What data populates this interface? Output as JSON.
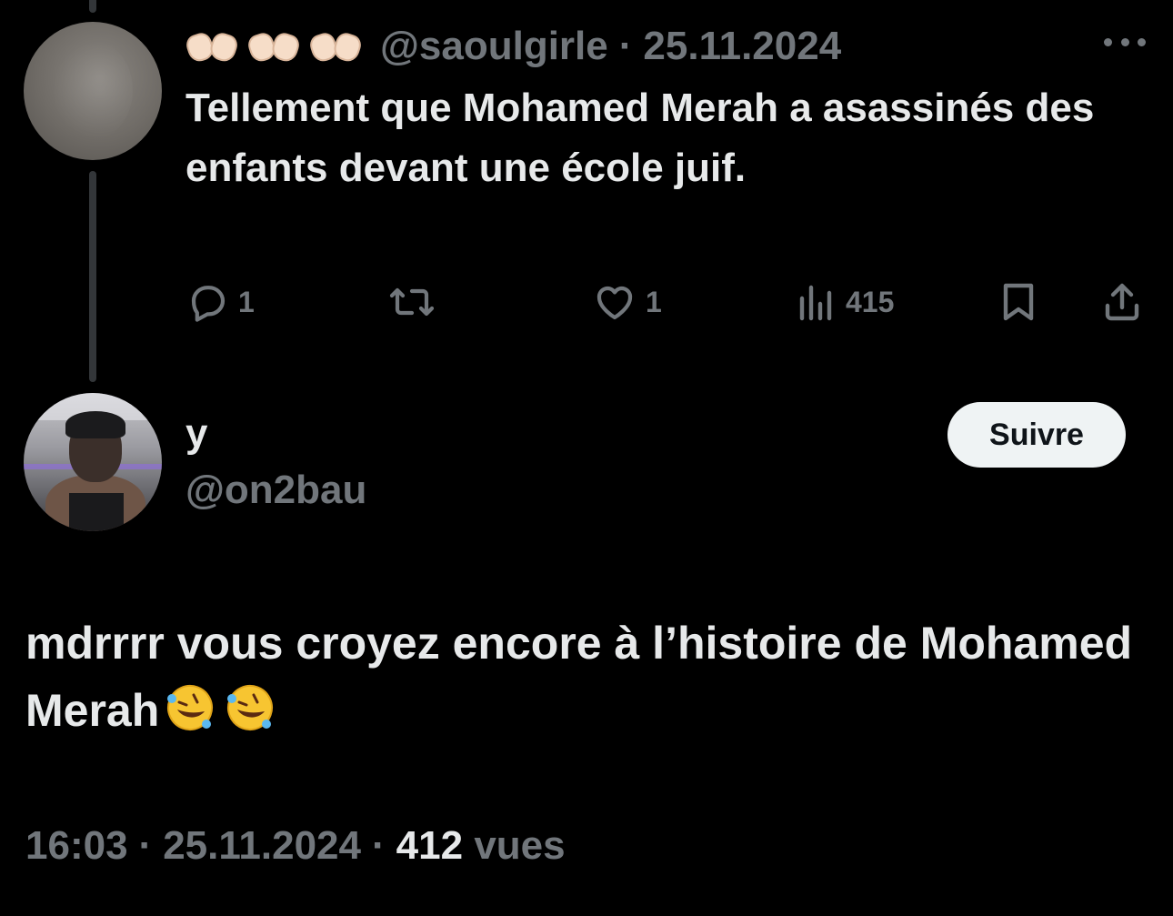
{
  "parent_tweet": {
    "header_emoji": "🙌🏻🙌🏻🙌🏻",
    "handle": "@saoulgirle",
    "separator": "·",
    "date": "25.11.2024",
    "text": "Tellement que Mohamed Merah a asassinés des enfants devant une école juif.",
    "actions": {
      "reply_count": "1",
      "retweet_count": "",
      "like_count": "1",
      "view_count": "415"
    }
  },
  "reply_tweet": {
    "display_name": "y",
    "handle": "@on2bau",
    "follow_label": "Suivre",
    "text": "mdrrrr vous croyez encore à l’histoire de Mohamed Merah",
    "text_emoji": "🤣🤣",
    "time": "16:03",
    "separator": "·",
    "date": "25.11.2024",
    "views_count": "412",
    "views_label": "vues"
  },
  "colors": {
    "background": "#000000",
    "primary_text": "#e7e9ea",
    "secondary_text": "#71767b",
    "thread_line": "#333639",
    "follow_button_bg": "#eff3f4"
  },
  "icons": [
    "more-icon",
    "reply-icon",
    "retweet-icon",
    "like-icon",
    "views-icon",
    "bookmark-icon",
    "share-icon"
  ]
}
